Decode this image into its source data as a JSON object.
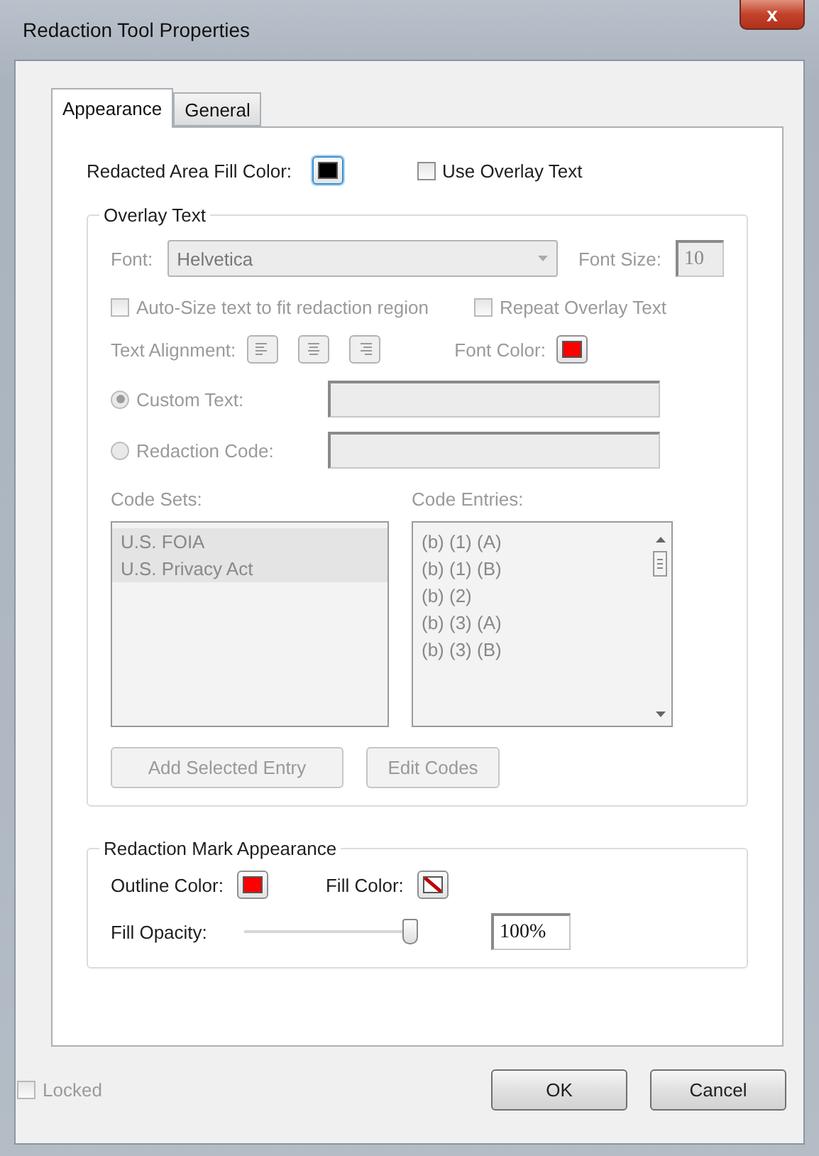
{
  "window": {
    "title": "Redaction Tool Properties",
    "close_label": "x"
  },
  "tabs": [
    {
      "label": "Appearance",
      "selected": true
    },
    {
      "label": "General",
      "selected": false
    }
  ],
  "fill_area": {
    "label": "Redacted Area Fill Color:",
    "color": "#000000"
  },
  "use_overlay": {
    "label": "Use Overlay Text",
    "checked": false
  },
  "overlay_text": {
    "title": "Overlay Text",
    "disabled": true,
    "font_label": "Font:",
    "font_value": "Helvetica",
    "size_label": "Font Size:",
    "size_value": "10",
    "checkboxes": [
      {
        "label": "Auto-Size text to fit redaction region",
        "checked": false
      },
      {
        "label": "Repeat Overlay Text",
        "checked": false
      }
    ],
    "alignment_label": "Text Alignment:",
    "alignments": [
      {
        "kind": "left",
        "selected": false
      },
      {
        "kind": "center",
        "selected": false
      },
      {
        "kind": "right",
        "selected": false
      }
    ],
    "font_color": {
      "label": "Font Color:",
      "color": "#ff0000"
    },
    "radios": [
      {
        "label": "Custom Text:",
        "selected": true
      },
      {
        "label": "Redaction Code:",
        "selected": false
      }
    ],
    "code_sets_label": "Code Sets:",
    "code_sets": [
      {
        "label": "U.S. FOIA",
        "selected": true
      },
      {
        "label": "U.S. Privacy Act",
        "selected": true
      }
    ],
    "code_entries_label": "Code Entries:",
    "code_entries": [
      "(b) (1) (A)",
      "(b) (1) (B)",
      "(b) (2)",
      "(b) (3) (A)",
      "(b) (3) (B)"
    ],
    "buttons": [
      "Add Selected Entry",
      "Edit Codes"
    ]
  },
  "mark_appearance": {
    "title": "Redaction Mark Appearance",
    "outline": {
      "label": "Outline Color:",
      "color": "#ff0000"
    },
    "fill": {
      "label": "Fill Color:",
      "kind": "none",
      "color": "#c00000"
    },
    "opacity_label": "Fill Opacity:",
    "level": 1,
    "opacity_value": "100%"
  },
  "locked": {
    "label": "Locked",
    "checked": false,
    "disabled": true
  },
  "buttons": [
    "OK",
    "Cancel"
  ]
}
